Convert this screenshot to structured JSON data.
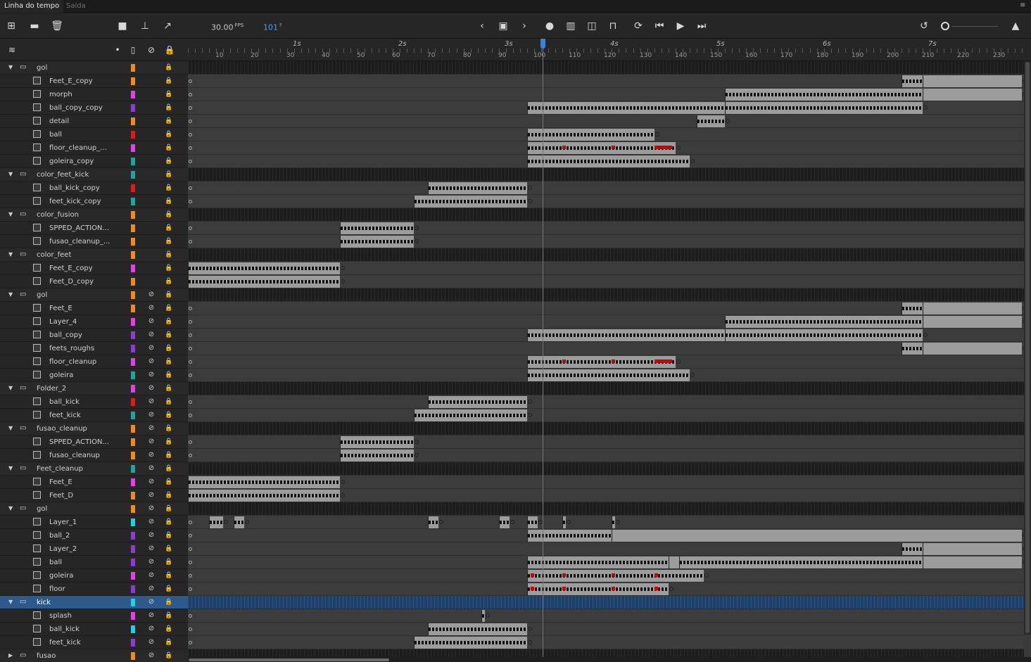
{
  "tabs": [
    {
      "label": "Linha do tempo",
      "active": true
    },
    {
      "label": "Saída",
      "active": false
    }
  ],
  "toolbar": {
    "fps_value": "30.00",
    "fps_unit": "FPS",
    "frame_value": "101",
    "frame_unit": "F"
  },
  "ruler": {
    "seconds": [
      "1s",
      "2s",
      "3s",
      "4s",
      "5s",
      "6s",
      "7s"
    ],
    "frames": [
      "10",
      "20",
      "30",
      "40",
      "50",
      "60",
      "70",
      "80",
      "90",
      "100",
      "110",
      "120",
      "130",
      "140",
      "150",
      "160",
      "170",
      "180",
      "190",
      "200",
      "210",
      "220",
      "230"
    ]
  },
  "colors": {
    "orange": "#f08a1e",
    "magenta": "#e83ee8",
    "purple": "#8a3ed1",
    "red": "#e01a1a",
    "teal": "#1aa7a0",
    "cyan": "#18d4e6",
    "playhead": "#3d82d6",
    "selected_row": "#2d5a8a"
  },
  "layers": [
    {
      "name": "gol",
      "folder": true,
      "indent": 0,
      "color": "orange",
      "hidden": false,
      "spans": []
    },
    {
      "name": "Feet_E_copy",
      "folder": false,
      "indent": 1,
      "color": "orange",
      "hidden": false,
      "spans": [
        [
          203,
          209,
          "kf"
        ],
        [
          209,
          237,
          "plain"
        ]
      ]
    },
    {
      "name": "morph",
      "folder": false,
      "indent": 1,
      "color": "magenta",
      "hidden": false,
      "spans": [
        [
          153,
          209,
          "kf"
        ],
        [
          209,
          237,
          "plain"
        ]
      ]
    },
    {
      "name": "ball_copy_copy",
      "folder": false,
      "indent": 1,
      "color": "purple",
      "hidden": false,
      "spans": [
        [
          97,
          153,
          "kf"
        ],
        [
          153,
          209,
          "kf"
        ]
      ]
    },
    {
      "name": "detail",
      "folder": false,
      "indent": 1,
      "color": "orange",
      "hidden": false,
      "spans": [
        [
          145,
          153,
          "kf"
        ]
      ]
    },
    {
      "name": "ball",
      "folder": false,
      "indent": 1,
      "color": "red",
      "hidden": false,
      "spans": [
        [
          97,
          133,
          "kf"
        ]
      ]
    },
    {
      "name": "floor_cleanup_...",
      "folder": false,
      "indent": 1,
      "color": "magenta",
      "hidden": false,
      "spans": [
        [
          97,
          139,
          "kf"
        ]
      ],
      "red": [
        [
          107,
          1
        ],
        [
          121,
          1
        ],
        [
          133,
          5
        ]
      ]
    },
    {
      "name": "goleira_copy",
      "folder": false,
      "indent": 1,
      "color": "teal",
      "hidden": false,
      "spans": [
        [
          97,
          143,
          "kf"
        ]
      ]
    },
    {
      "name": "color_feet_kick",
      "folder": true,
      "indent": 0,
      "color": "teal",
      "hidden": false,
      "spans": []
    },
    {
      "name": "ball_kick_copy",
      "folder": false,
      "indent": 1,
      "color": "red",
      "hidden": false,
      "spans": [
        [
          69,
          97,
          "kf"
        ]
      ]
    },
    {
      "name": "feet_kick_copy",
      "folder": false,
      "indent": 1,
      "color": "teal",
      "hidden": false,
      "spans": [
        [
          65,
          97,
          "kf"
        ]
      ]
    },
    {
      "name": "color_fusion",
      "folder": true,
      "indent": 0,
      "color": "orange",
      "hidden": false,
      "spans": []
    },
    {
      "name": "SPPED_ACTION...",
      "folder": false,
      "indent": 1,
      "color": "orange",
      "hidden": false,
      "spans": [
        [
          44,
          65,
          "kf"
        ]
      ]
    },
    {
      "name": "fusao_cleanup_...",
      "folder": false,
      "indent": 1,
      "color": "orange",
      "hidden": false,
      "spans": [
        [
          44,
          65,
          "kf"
        ]
      ]
    },
    {
      "name": "color_feet",
      "folder": true,
      "indent": 0,
      "color": "orange",
      "hidden": false,
      "spans": []
    },
    {
      "name": "Feet_E_copy",
      "folder": false,
      "indent": 1,
      "color": "magenta",
      "hidden": false,
      "spans": [
        [
          1,
          44,
          "kf"
        ]
      ]
    },
    {
      "name": "Feet_D_copy",
      "folder": false,
      "indent": 1,
      "color": "orange",
      "hidden": false,
      "spans": [
        [
          1,
          44,
          "kf"
        ]
      ]
    },
    {
      "name": "gol",
      "folder": true,
      "indent": 0,
      "color": "orange",
      "hidden": true,
      "spans": []
    },
    {
      "name": "Feet_E",
      "folder": false,
      "indent": 1,
      "color": "orange",
      "hidden": true,
      "spans": [
        [
          203,
          209,
          "kf"
        ],
        [
          209,
          237,
          "plain"
        ]
      ]
    },
    {
      "name": "Layer_4",
      "folder": false,
      "indent": 1,
      "color": "magenta",
      "hidden": true,
      "spans": [
        [
          153,
          209,
          "kf"
        ],
        [
          209,
          237,
          "plain"
        ]
      ]
    },
    {
      "name": "ball_copy",
      "folder": false,
      "indent": 1,
      "color": "purple",
      "hidden": true,
      "spans": [
        [
          97,
          153,
          "kf"
        ],
        [
          153,
          209,
          "kf"
        ]
      ]
    },
    {
      "name": "feets_roughs",
      "folder": false,
      "indent": 1,
      "color": "purple",
      "hidden": true,
      "spans": [
        [
          203,
          209,
          "kf"
        ],
        [
          209,
          237,
          "plain"
        ]
      ]
    },
    {
      "name": "floor_cleanup",
      "folder": false,
      "indent": 1,
      "color": "magenta",
      "hidden": true,
      "spans": [
        [
          97,
          139,
          "kf"
        ]
      ],
      "red": [
        [
          107,
          1
        ],
        [
          121,
          1
        ],
        [
          133,
          5
        ]
      ]
    },
    {
      "name": "goleira",
      "folder": false,
      "indent": 1,
      "color": "teal",
      "hidden": true,
      "spans": [
        [
          97,
          143,
          "kf"
        ]
      ]
    },
    {
      "name": "Folder_2",
      "folder": true,
      "indent": 0,
      "color": "magenta",
      "hidden": true,
      "spans": []
    },
    {
      "name": "ball_kick",
      "folder": false,
      "indent": 1,
      "color": "red",
      "hidden": true,
      "spans": [
        [
          69,
          97,
          "kf"
        ]
      ]
    },
    {
      "name": "feet_kick",
      "folder": false,
      "indent": 1,
      "color": "teal",
      "hidden": true,
      "spans": [
        [
          65,
          97,
          "kf"
        ]
      ]
    },
    {
      "name": "fusao_cleanup",
      "folder": true,
      "indent": 0,
      "color": "orange",
      "hidden": true,
      "spans": []
    },
    {
      "name": "SPPED_ACTION...",
      "folder": false,
      "indent": 1,
      "color": "orange",
      "hidden": true,
      "spans": [
        [
          44,
          65,
          "kf"
        ]
      ]
    },
    {
      "name": "fusao_cleanup",
      "folder": false,
      "indent": 1,
      "color": "orange",
      "hidden": true,
      "spans": [
        [
          44,
          65,
          "kf"
        ]
      ]
    },
    {
      "name": "Feet_cleanup",
      "folder": true,
      "indent": 0,
      "color": "teal",
      "hidden": true,
      "spans": []
    },
    {
      "name": "Feet_E",
      "folder": false,
      "indent": 1,
      "color": "magenta",
      "hidden": true,
      "spans": [
        [
          1,
          44,
          "kf"
        ]
      ]
    },
    {
      "name": "Feet_D",
      "folder": false,
      "indent": 1,
      "color": "orange",
      "hidden": true,
      "spans": [
        [
          1,
          44,
          "kf"
        ]
      ]
    },
    {
      "name": "gol",
      "folder": true,
      "indent": 0,
      "color": "orange",
      "hidden": true,
      "spans": []
    },
    {
      "name": "Layer_1",
      "folder": false,
      "indent": 1,
      "color": "cyan",
      "hidden": true,
      "spans": [
        [
          7,
          11,
          "kf"
        ],
        [
          14,
          17,
          "kf"
        ],
        [
          69,
          72,
          "kf"
        ],
        [
          89,
          92,
          "kf"
        ],
        [
          97,
          100,
          "kf"
        ],
        [
          107,
          108,
          "kf"
        ],
        [
          121,
          122,
          "kf"
        ]
      ]
    },
    {
      "name": "ball_2",
      "folder": false,
      "indent": 1,
      "color": "purple",
      "hidden": true,
      "spans": [
        [
          97,
          121,
          "kf"
        ],
        [
          121,
          237,
          "plain"
        ]
      ]
    },
    {
      "name": "Layer_2",
      "folder": false,
      "indent": 1,
      "color": "purple",
      "hidden": true,
      "spans": [
        [
          203,
          209,
          "kf"
        ],
        [
          209,
          237,
          "plain"
        ]
      ]
    },
    {
      "name": "ball",
      "folder": false,
      "indent": 1,
      "color": "purple",
      "hidden": true,
      "spans": [
        [
          97,
          137,
          "kf"
        ],
        [
          137,
          140,
          "plain"
        ],
        [
          140,
          209,
          "kf"
        ],
        [
          209,
          237,
          "plain"
        ]
      ]
    },
    {
      "name": "goleira",
      "folder": false,
      "indent": 1,
      "color": "magenta",
      "hidden": true,
      "spans": [
        [
          97,
          147,
          "kf"
        ]
      ],
      "red": [
        [
          98,
          1
        ],
        [
          107,
          1
        ],
        [
          121,
          1
        ],
        [
          133,
          1
        ]
      ]
    },
    {
      "name": "floor",
      "folder": false,
      "indent": 1,
      "color": "purple",
      "hidden": true,
      "spans": [
        [
          97,
          137,
          "kf"
        ]
      ],
      "red": [
        [
          98,
          1
        ],
        [
          107,
          1
        ],
        [
          121,
          1
        ],
        [
          133,
          1
        ]
      ]
    },
    {
      "name": "kick",
      "folder": true,
      "indent": 0,
      "color": "cyan",
      "hidden": true,
      "selected": true,
      "spans": []
    },
    {
      "name": "splash",
      "folder": false,
      "indent": 1,
      "color": "magenta",
      "hidden": true,
      "spans": [
        [
          84,
          85,
          "kf"
        ]
      ]
    },
    {
      "name": "ball_kick",
      "folder": false,
      "indent": 1,
      "color": "cyan",
      "hidden": true,
      "spans": [
        [
          69,
          97,
          "kf"
        ]
      ]
    },
    {
      "name": "feet_kick",
      "folder": false,
      "indent": 1,
      "color": "purple",
      "hidden": true,
      "spans": [
        [
          65,
          97,
          "kf"
        ]
      ]
    },
    {
      "name": "fusao",
      "folder": true,
      "indent": 0,
      "color": "orange",
      "hidden": true,
      "collapsed": true,
      "spans": []
    }
  ]
}
